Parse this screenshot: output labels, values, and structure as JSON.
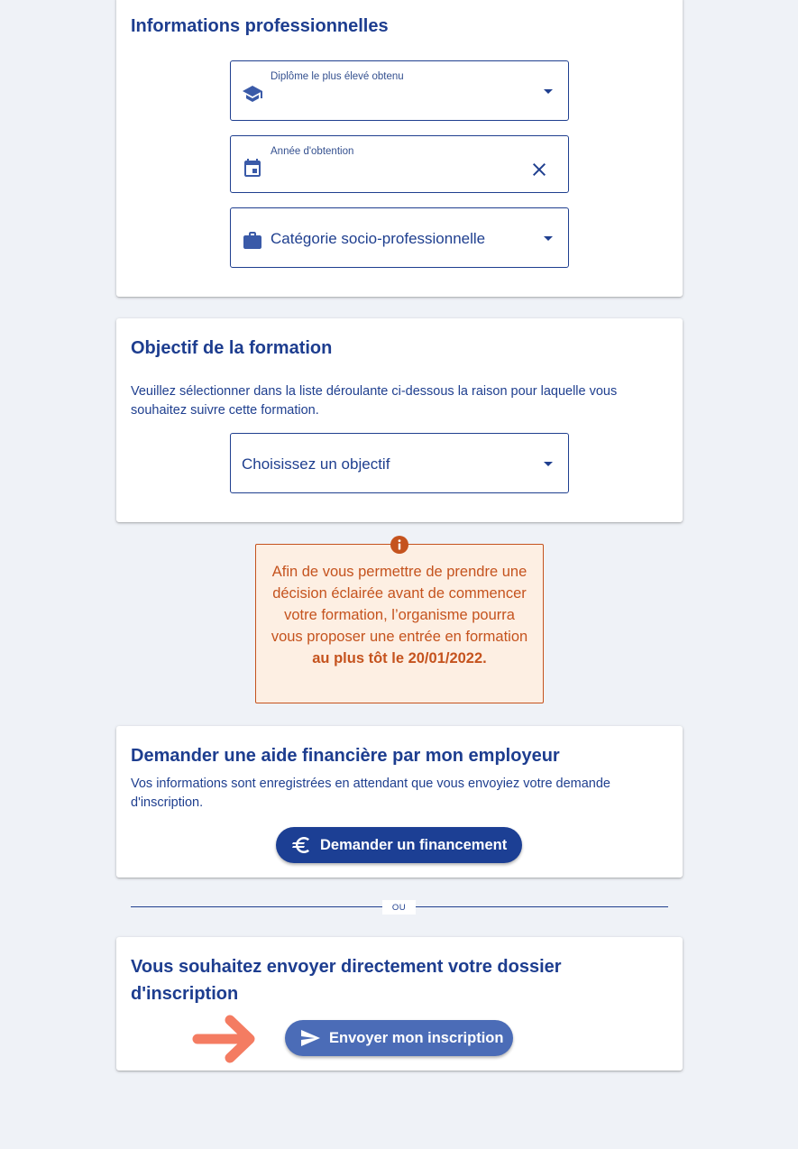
{
  "professional_info": {
    "title": "Informations professionnelles",
    "diploma": {
      "label": "Diplôme le plus élevé obtenu",
      "icon": "graduation-cap-icon"
    },
    "year": {
      "label": "Année d'obtention",
      "icon": "calendar-icon",
      "clear_icon": "close-icon"
    },
    "category": {
      "value": "Catégorie socio-professionnelle",
      "icon": "briefcase-icon"
    }
  },
  "objective": {
    "title": "Objectif de la formation",
    "description": "Veuillez sélectionner dans la liste déroulante ci-dessous la raison pour laquelle vous souhaitez suivre cette formation.",
    "select_value": "Choisissez un objectif"
  },
  "info_notice": {
    "icon": "info-icon",
    "text_start": "Afin de vous permettre de prendre une décision éclairée avant de commencer votre formation, l’organisme pourra vous proposer une entrée en formation ",
    "text_bold": "au plus tôt le 20/01/2022."
  },
  "employer_funding": {
    "title": "Demander une aide financière par mon employeur",
    "description": "Vos informations sont enregistrées en attendant que vous envoyiez votre demande d'inscription.",
    "button_label": "Demander un financement",
    "button_icon": "euro-icon"
  },
  "divider": {
    "label": "OU"
  },
  "direct_submit": {
    "title": "Vous souhaitez envoyer directement votre dossier d'inscription",
    "button_label": "Envoyer mon inscription",
    "button_icon": "send-icon",
    "pointer_icon": "arrow-right-icon"
  },
  "colors": {
    "page_background": "#eff2f7",
    "primary": "#1d3d8f",
    "primary_button": "#1c3f94",
    "secondary_button": "#4b6cb7",
    "warning_text": "#c5531e",
    "warning_background": "#fdefe3",
    "annotation_arrow": "#f47c62"
  }
}
